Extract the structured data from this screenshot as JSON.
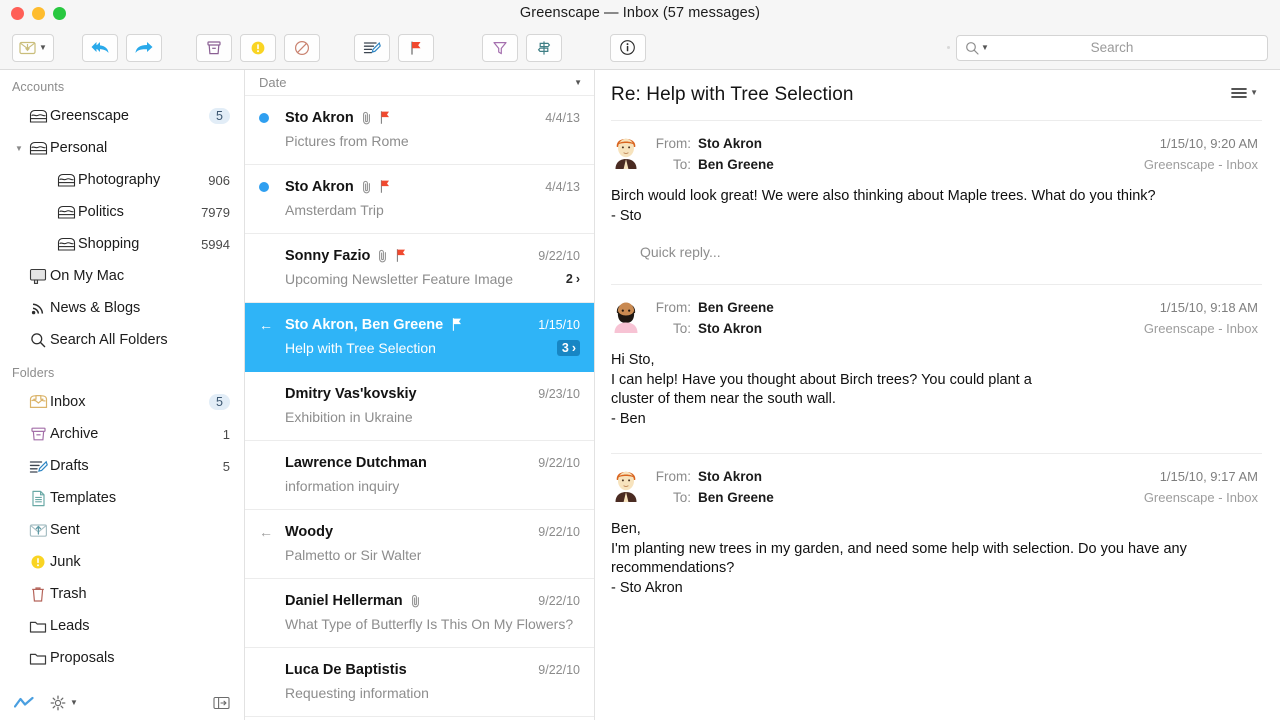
{
  "window": {
    "title": "Greenscape — Inbox (57 messages)",
    "accent_blue": "#2fb4f7",
    "badge_blue": "#1786c4",
    "unread_dot": "#2f9ff0"
  },
  "toolbar": {
    "get_mail": {
      "name": "get-mail",
      "label": ""
    },
    "reply_all": {
      "name": "reply-all",
      "label": ""
    },
    "forward": {
      "name": "forward",
      "label": ""
    },
    "archive": {
      "name": "archive",
      "label": ""
    },
    "junk": {
      "name": "junk",
      "label": ""
    },
    "block": {
      "name": "block",
      "label": ""
    },
    "compose": {
      "name": "compose",
      "label": ""
    },
    "flag": {
      "name": "flag",
      "label": ""
    },
    "filter": {
      "name": "filter",
      "label": ""
    },
    "sort": {
      "name": "sort",
      "label": ""
    },
    "info": {
      "name": "info",
      "label": ""
    },
    "search_placeholder": "Search"
  },
  "sidebar": {
    "accounts_header": "Accounts",
    "folders_header": "Folders",
    "accounts": [
      {
        "label": "Greenscape",
        "count": "5",
        "icon": "mailbox-icon",
        "indent": 1,
        "twisty": "",
        "pill": true
      },
      {
        "label": "Personal",
        "count": "",
        "icon": "mailbox-icon",
        "indent": 1,
        "twisty": "▼",
        "pill": false
      },
      {
        "label": "Photography",
        "count": "906",
        "icon": "mailbox-icon",
        "indent": 2,
        "twisty": "",
        "pill": false
      },
      {
        "label": "Politics",
        "count": "7979",
        "icon": "mailbox-icon",
        "indent": 2,
        "twisty": "",
        "pill": false
      },
      {
        "label": "Shopping",
        "count": "5994",
        "icon": "mailbox-icon",
        "indent": 2,
        "twisty": "",
        "pill": false
      },
      {
        "label": "On My Mac",
        "count": "",
        "icon": "computer-icon",
        "indent": 1,
        "twisty": "",
        "pill": false
      },
      {
        "label": "News & Blogs",
        "count": "",
        "icon": "rss-icon",
        "indent": 1,
        "twisty": "",
        "pill": false
      },
      {
        "label": "Search All Folders",
        "count": "",
        "icon": "search-icon",
        "indent": 1,
        "twisty": "",
        "pill": false
      }
    ],
    "folders": [
      {
        "label": "Inbox",
        "count": "5",
        "icon": "inbox-icon",
        "pill": true
      },
      {
        "label": "Archive",
        "count": "1",
        "icon": "archive-icon",
        "pill": false
      },
      {
        "label": "Drafts",
        "count": "5",
        "icon": "drafts-icon",
        "pill": false
      },
      {
        "label": "Templates",
        "count": "",
        "icon": "templates-icon",
        "pill": false
      },
      {
        "label": "Sent",
        "count": "",
        "icon": "sent-icon",
        "pill": false
      },
      {
        "label": "Junk",
        "count": "",
        "icon": "junk-icon",
        "pill": false
      },
      {
        "label": "Trash",
        "count": "",
        "icon": "trash-icon",
        "pill": false
      },
      {
        "label": "Leads",
        "count": "",
        "icon": "folder-icon",
        "pill": false
      },
      {
        "label": "Proposals",
        "count": "",
        "icon": "folder-icon",
        "pill": false
      }
    ]
  },
  "message_list": {
    "sort_header": "Date",
    "rows": [
      {
        "from": "Sto Akron",
        "subject": "Pictures from Rome",
        "date": "4/4/13",
        "unread": true,
        "attachment": true,
        "flag": true,
        "replied": false,
        "count": ""
      },
      {
        "from": "Sto Akron",
        "subject": "Amsterdam Trip",
        "date": "4/4/13",
        "unread": true,
        "attachment": true,
        "flag": true,
        "replied": false,
        "count": ""
      },
      {
        "from": "Sonny Fazio",
        "subject": "Upcoming Newsletter Feature Image",
        "date": "9/22/10",
        "unread": false,
        "attachment": true,
        "flag": true,
        "replied": false,
        "count": "2"
      },
      {
        "from": "Sto Akron, Ben Greene",
        "subject": "Help with Tree Selection",
        "date": "1/15/10",
        "unread": false,
        "attachment": false,
        "flag": true,
        "replied": true,
        "count": "3",
        "selected": true
      },
      {
        "from": "Dmitry Vas'kovskiy",
        "subject": "Exhibition in Ukraine",
        "date": "9/23/10",
        "unread": false,
        "attachment": false,
        "flag": false,
        "replied": false,
        "count": ""
      },
      {
        "from": "Lawrence Dutchman",
        "subject": "information inquiry",
        "date": "9/22/10",
        "unread": false,
        "attachment": false,
        "flag": false,
        "replied": false,
        "count": ""
      },
      {
        "from": "Woody",
        "subject": "Palmetto or Sir Walter",
        "date": "9/22/10",
        "unread": false,
        "attachment": false,
        "flag": false,
        "replied": true,
        "count": ""
      },
      {
        "from": "Daniel Hellerman",
        "subject": "What Type of Butterfly Is This On My Flowers?",
        "date": "9/22/10",
        "unread": false,
        "attachment": true,
        "flag": false,
        "replied": false,
        "count": ""
      },
      {
        "from": "Luca De Baptistis",
        "subject": "Requesting information",
        "date": "9/22/10",
        "unread": false,
        "attachment": false,
        "flag": false,
        "replied": false,
        "count": ""
      }
    ]
  },
  "reading_pane": {
    "title": "Re: Help with Tree Selection",
    "from_label": "From:",
    "to_label": "To:",
    "quick_reply_placeholder": "Quick reply...",
    "messages": [
      {
        "avatar": "avatar-sto-akron",
        "from": "Sto Akron",
        "to": "Ben Greene",
        "time": "1/15/10, 9:20 AM",
        "mailbox": "Greenscape - Inbox",
        "body_line1": "Birch would look great!  We were also thinking about Maple trees.  What do you think?",
        "body_line2": "- Sto",
        "body_line3": ""
      },
      {
        "avatar": "avatar-ben-greene",
        "from": "Ben Greene",
        "to": "Sto Akron",
        "time": "1/15/10, 9:18 AM",
        "mailbox": "Greenscape - Inbox",
        "body_line1": "Hi Sto,",
        "body_line2": "I can help!  Have you thought about Birch trees?  You could plant a",
        "body_line3": "cluster of them near the south wall.",
        "body_line4": "- Ben"
      },
      {
        "avatar": "avatar-sto-akron",
        "from": "Sto Akron",
        "to": "Ben Greene",
        "time": "1/15/10, 9:17 AM",
        "mailbox": "Greenscape - Inbox",
        "body_line1": "Ben,",
        "body_line2": "I'm planting new trees in my garden, and need some help with selection.  Do you have any",
        "body_line3": "recommendations?",
        "body_line4": "- Sto Akron"
      }
    ]
  }
}
